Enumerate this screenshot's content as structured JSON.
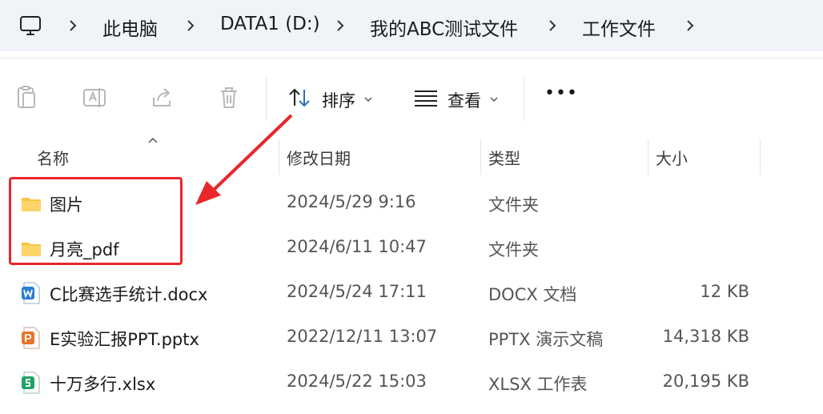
{
  "breadcrumb": {
    "items": [
      "此电脑",
      "DATA1 (D:)",
      "我的ABC测试文件",
      "工作文件"
    ]
  },
  "toolbar": {
    "sort_label": "排序",
    "view_label": "查看",
    "more_label": "•••"
  },
  "columns": {
    "name": "名称",
    "date": "修改日期",
    "type": "类型",
    "size": "大小"
  },
  "files": [
    {
      "name": "图片",
      "date": "2024/5/29 9:16",
      "type": "文件夹",
      "size": "",
      "icon": "folder-icon"
    },
    {
      "name": "月亮_pdf",
      "date": "2024/6/11 10:47",
      "type": "文件夹",
      "size": "",
      "icon": "folder-icon"
    },
    {
      "name": "C比赛选手统计.docx",
      "date": "2024/5/24 17:11",
      "type": "DOCX 文档",
      "size": "12 KB",
      "icon": "word-doc-icon"
    },
    {
      "name": "E实验汇报PPT.pptx",
      "date": "2022/12/11 13:07",
      "type": "PPTX 演示文稿",
      "size": "14,318 KB",
      "icon": "ppt-doc-icon"
    },
    {
      "name": "十万多行.xlsx",
      "date": "2024/5/22 15:03",
      "type": "XLSX 工作表",
      "size": "20,195 KB",
      "icon": "excel-doc-icon"
    }
  ],
  "colors": {
    "highlight": "#e8272b",
    "folder": "#f8c542",
    "word": "#2b7cd3",
    "ppt": "#e8742a",
    "excel": "#21a366"
  }
}
